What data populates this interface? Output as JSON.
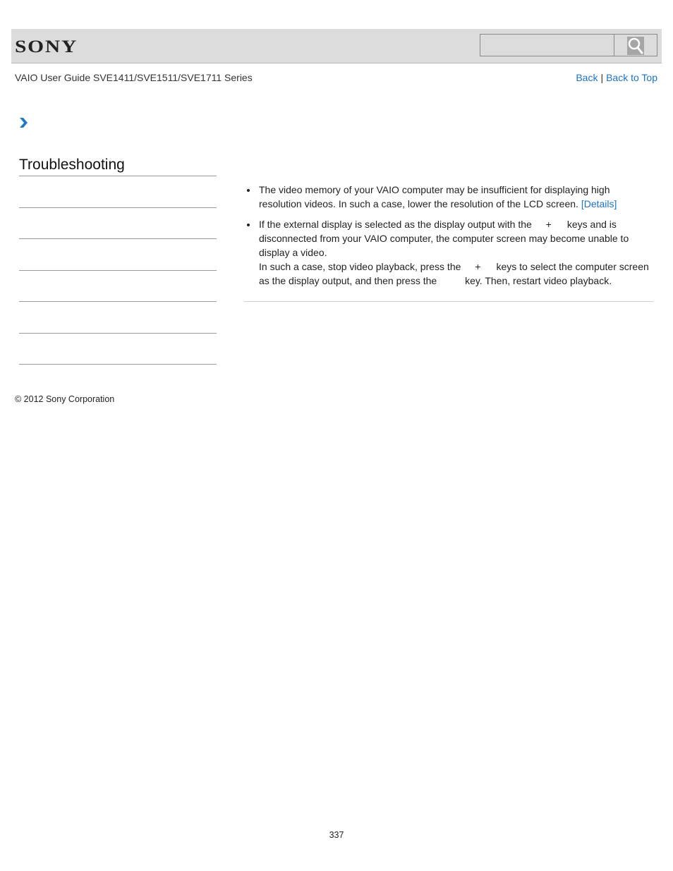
{
  "header": {
    "logo": "SONY",
    "search": {
      "value": "",
      "placeholder": ""
    },
    "search_icon": "search-icon"
  },
  "subheader": {
    "title": "VAIO User Guide SVE1411/SVE1511/SVE1711 Series",
    "back_label": "Back",
    "separator": "|",
    "back_to_top_label": "Back to Top"
  },
  "breadcrumb": {
    "icon": "chevron-right-icon"
  },
  "sidebar": {
    "title": "Troubleshooting",
    "items": [
      "",
      "",
      "",
      "",
      "",
      ""
    ]
  },
  "content": {
    "bullets": [
      {
        "text": "The video memory of your VAIO computer may be insufficient for displaying high resolution videos. In such a case, lower the resolution of the LCD screen. ",
        "link": "[Details]"
      },
      {
        "part1": "If the external display is selected as the display output with the",
        "plus1": "+",
        "part2": "keys and is disconnected from your VAIO computer, the computer screen may become unable to display a video.",
        "part3": "In such a case, stop video playback, press the",
        "plus2": "+",
        "part4": "keys to select the computer screen as the display output, and then press the",
        "part5": "key. Then, restart video playback."
      }
    ]
  },
  "footer": {
    "copyright": "© 2012 Sony Corporation",
    "page_number": "337"
  },
  "colors": {
    "link": "#1a73c8",
    "header_bg": "#dcdcdc",
    "chevron": "#1f7ac4"
  }
}
